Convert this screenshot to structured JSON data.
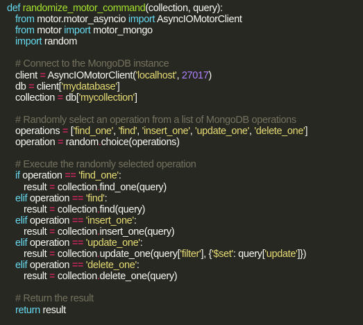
{
  "lines": [
    {
      "indent": 0,
      "tokens": [
        {
          "t": "kw",
          "v": "def "
        },
        {
          "t": "fn",
          "v": "randomize_motor_command"
        },
        {
          "t": "pl",
          "v": "(collection, query):"
        }
      ]
    },
    {
      "indent": 1,
      "tokens": [
        {
          "t": "kw",
          "v": "from "
        },
        {
          "t": "pl",
          "v": "motor.motor_asyncio "
        },
        {
          "t": "kw",
          "v": "import "
        },
        {
          "t": "pl",
          "v": "AsyncIOMotorClient"
        }
      ]
    },
    {
      "indent": 1,
      "tokens": [
        {
          "t": "kw",
          "v": "from "
        },
        {
          "t": "pl",
          "v": "motor "
        },
        {
          "t": "kw",
          "v": "import "
        },
        {
          "t": "pl",
          "v": "motor_mongo"
        }
      ]
    },
    {
      "indent": 1,
      "tokens": [
        {
          "t": "kw",
          "v": "import "
        },
        {
          "t": "pl",
          "v": "random"
        }
      ]
    },
    {
      "indent": 0,
      "tokens": []
    },
    {
      "indent": 1,
      "tokens": [
        {
          "t": "cm",
          "v": "# Connect to the MongoDB instance"
        }
      ]
    },
    {
      "indent": 1,
      "tokens": [
        {
          "t": "pl",
          "v": "client "
        },
        {
          "t": "op",
          "v": "="
        },
        {
          "t": "pl",
          "v": " AsyncIOMotorClient("
        },
        {
          "t": "str",
          "v": "'localhost'"
        },
        {
          "t": "pl",
          "v": ", "
        },
        {
          "t": "num",
          "v": "27017"
        },
        {
          "t": "pl",
          "v": ")"
        }
      ]
    },
    {
      "indent": 1,
      "tokens": [
        {
          "t": "pl",
          "v": "db "
        },
        {
          "t": "op",
          "v": "="
        },
        {
          "t": "pl",
          "v": " client["
        },
        {
          "t": "str",
          "v": "'mydatabase'"
        },
        {
          "t": "pl",
          "v": "]"
        }
      ]
    },
    {
      "indent": 1,
      "tokens": [
        {
          "t": "pl",
          "v": "collection "
        },
        {
          "t": "op",
          "v": "="
        },
        {
          "t": "pl",
          "v": " db["
        },
        {
          "t": "str",
          "v": "'mycollection'"
        },
        {
          "t": "pl",
          "v": "]"
        }
      ]
    },
    {
      "indent": 0,
      "tokens": []
    },
    {
      "indent": 1,
      "tokens": [
        {
          "t": "cm",
          "v": "# Randomly select an operation from a list of MongoDB operations"
        }
      ]
    },
    {
      "indent": 1,
      "tokens": [
        {
          "t": "pl",
          "v": "operations "
        },
        {
          "t": "op",
          "v": "="
        },
        {
          "t": "pl",
          "v": " ["
        },
        {
          "t": "str",
          "v": "'find_one'"
        },
        {
          "t": "pl",
          "v": ", "
        },
        {
          "t": "str",
          "v": "'find'"
        },
        {
          "t": "pl",
          "v": ", "
        },
        {
          "t": "str",
          "v": "'insert_one'"
        },
        {
          "t": "pl",
          "v": ", "
        },
        {
          "t": "str",
          "v": "'update_one'"
        },
        {
          "t": "pl",
          "v": ", "
        },
        {
          "t": "str",
          "v": "'delete_one'"
        },
        {
          "t": "pl",
          "v": "]"
        }
      ]
    },
    {
      "indent": 1,
      "tokens": [
        {
          "t": "pl",
          "v": "operation "
        },
        {
          "t": "op",
          "v": "="
        },
        {
          "t": "pl",
          "v": " random"
        },
        {
          "t": "op",
          "v": "."
        },
        {
          "t": "pl",
          "v": "choice(operations)"
        }
      ]
    },
    {
      "indent": 0,
      "tokens": []
    },
    {
      "indent": 1,
      "tokens": [
        {
          "t": "cm",
          "v": "# Execute the randomly selected operation"
        }
      ]
    },
    {
      "indent": 1,
      "tokens": [
        {
          "t": "kw",
          "v": "if "
        },
        {
          "t": "pl",
          "v": "operation "
        },
        {
          "t": "op",
          "v": "=="
        },
        {
          "t": "pl",
          "v": " "
        },
        {
          "t": "str",
          "v": "'find_one'"
        },
        {
          "t": "pl",
          "v": ":"
        }
      ]
    },
    {
      "indent": 2,
      "tokens": [
        {
          "t": "pl",
          "v": "result "
        },
        {
          "t": "op",
          "v": "="
        },
        {
          "t": "pl",
          "v": " collection"
        },
        {
          "t": "op",
          "v": "."
        },
        {
          "t": "pl",
          "v": "find_one(query)"
        }
      ]
    },
    {
      "indent": 1,
      "tokens": [
        {
          "t": "kw",
          "v": "elif "
        },
        {
          "t": "pl",
          "v": "operation "
        },
        {
          "t": "op",
          "v": "=="
        },
        {
          "t": "pl",
          "v": " "
        },
        {
          "t": "str",
          "v": "'find'"
        },
        {
          "t": "pl",
          "v": ":"
        }
      ]
    },
    {
      "indent": 2,
      "tokens": [
        {
          "t": "pl",
          "v": "result "
        },
        {
          "t": "op",
          "v": "="
        },
        {
          "t": "pl",
          "v": " collection"
        },
        {
          "t": "op",
          "v": "."
        },
        {
          "t": "pl",
          "v": "find(query)"
        }
      ]
    },
    {
      "indent": 1,
      "tokens": [
        {
          "t": "kw",
          "v": "elif "
        },
        {
          "t": "pl",
          "v": "operation "
        },
        {
          "t": "op",
          "v": "=="
        },
        {
          "t": "pl",
          "v": " "
        },
        {
          "t": "str",
          "v": "'insert_one'"
        },
        {
          "t": "pl",
          "v": ":"
        }
      ]
    },
    {
      "indent": 2,
      "tokens": [
        {
          "t": "pl",
          "v": "result "
        },
        {
          "t": "op",
          "v": "="
        },
        {
          "t": "pl",
          "v": " collection"
        },
        {
          "t": "op",
          "v": "."
        },
        {
          "t": "pl",
          "v": "insert_one(query)"
        }
      ]
    },
    {
      "indent": 1,
      "tokens": [
        {
          "t": "kw",
          "v": "elif "
        },
        {
          "t": "pl",
          "v": "operation "
        },
        {
          "t": "op",
          "v": "=="
        },
        {
          "t": "pl",
          "v": " "
        },
        {
          "t": "str",
          "v": "'update_one'"
        },
        {
          "t": "pl",
          "v": ":"
        }
      ]
    },
    {
      "indent": 2,
      "tokens": [
        {
          "t": "pl",
          "v": "result "
        },
        {
          "t": "op",
          "v": "="
        },
        {
          "t": "pl",
          "v": " collection"
        },
        {
          "t": "op",
          "v": "."
        },
        {
          "t": "pl",
          "v": "update_one(query["
        },
        {
          "t": "str",
          "v": "'filter'"
        },
        {
          "t": "pl",
          "v": "], {"
        },
        {
          "t": "str",
          "v": "'$set'"
        },
        {
          "t": "pl",
          "v": ": query["
        },
        {
          "t": "str",
          "v": "'update'"
        },
        {
          "t": "pl",
          "v": "]})"
        }
      ]
    },
    {
      "indent": 1,
      "tokens": [
        {
          "t": "kw",
          "v": "elif "
        },
        {
          "t": "pl",
          "v": "operation "
        },
        {
          "t": "op",
          "v": "=="
        },
        {
          "t": "pl",
          "v": " "
        },
        {
          "t": "str",
          "v": "'delete_one'"
        },
        {
          "t": "pl",
          "v": ":"
        }
      ]
    },
    {
      "indent": 2,
      "tokens": [
        {
          "t": "pl",
          "v": "result "
        },
        {
          "t": "op",
          "v": "="
        },
        {
          "t": "pl",
          "v": " collection"
        },
        {
          "t": "op",
          "v": "."
        },
        {
          "t": "pl",
          "v": "delete_one(query)"
        }
      ]
    },
    {
      "indent": 0,
      "tokens": []
    },
    {
      "indent": 1,
      "tokens": [
        {
          "t": "cm",
          "v": "# Return the result"
        }
      ]
    },
    {
      "indent": 1,
      "tokens": [
        {
          "t": "kw",
          "v": "return "
        },
        {
          "t": "pl",
          "v": "result"
        }
      ]
    }
  ]
}
